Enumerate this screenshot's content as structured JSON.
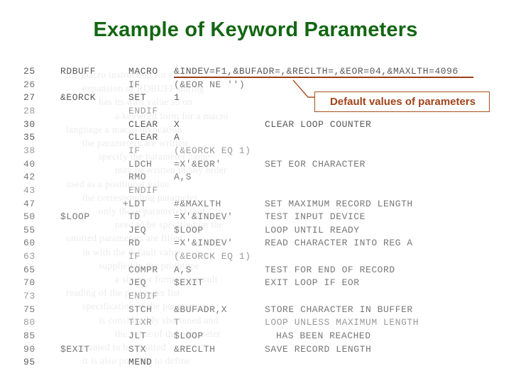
{
  "slide": {
    "title": "Example of Keyword Parameters",
    "title_color": "#136613"
  },
  "callout": {
    "text": "Default values of parameters",
    "color": "#a0441c",
    "border_color": "#a8511f",
    "leader_icon": "leader-line-icon"
  },
  "listing": {
    "underline_color": "#a03c17",
    "columns": [
      "line",
      "label",
      "opcode",
      "operand",
      "comment"
    ],
    "rows": [
      {
        "line": "25",
        "label": "RDBUFF",
        "plus": "",
        "opcode": "MACRO",
        "operand": "&INDEV=F1,&BUFADR=,&RECLTH=,&EOR=04,&MAXLTH=4096",
        "comment": "",
        "underline": true,
        "tone": "dark"
      },
      {
        "line": "26",
        "label": "",
        "plus": "",
        "opcode": "IF",
        "operand": "(&EOR NE '')",
        "comment": "",
        "underline": false,
        "tone": "mid"
      },
      {
        "line": "27",
        "label": "&EORCK",
        "plus": "",
        "opcode": "SET",
        "operand": "1",
        "comment": "",
        "underline": false,
        "tone": "dark"
      },
      {
        "line": "28",
        "label": "",
        "plus": "",
        "opcode": "ENDIF",
        "operand": "",
        "comment": "",
        "underline": false,
        "tone": "light"
      },
      {
        "line": "30",
        "label": "",
        "plus": "",
        "opcode": "CLEAR",
        "operand": "X",
        "comment": "CLEAR LOOP COUNTER",
        "underline": false,
        "tone": "dark"
      },
      {
        "line": "35",
        "label": "",
        "plus": "",
        "opcode": "CLEAR",
        "operand": "A",
        "comment": "",
        "underline": false,
        "tone": "dark"
      },
      {
        "line": "38",
        "label": "",
        "plus": "",
        "opcode": "IF",
        "operand": "(&EORCK EQ 1)",
        "comment": "",
        "underline": false,
        "tone": "light"
      },
      {
        "line": "40",
        "label": "",
        "plus": "",
        "opcode": "LDCH",
        "operand": "=X'&EOR'",
        "comment": "SET EOR CHARACTER",
        "underline": false,
        "tone": "mid"
      },
      {
        "line": "42",
        "label": "",
        "plus": "",
        "opcode": "RMO",
        "operand": "A,S",
        "comment": "",
        "underline": false,
        "tone": "mid"
      },
      {
        "line": "43",
        "label": "",
        "plus": "",
        "opcode": "ENDIF",
        "operand": "",
        "comment": "",
        "underline": false,
        "tone": "light"
      },
      {
        "line": "47",
        "label": "",
        "plus": "+",
        "opcode": "LDT",
        "operand": "#&MAXLTH",
        "comment": "SET MAXIMUM RECORD LENGTH",
        "underline": false,
        "tone": "mid"
      },
      {
        "line": "50",
        "label": "$LOOP",
        "plus": "",
        "opcode": "TD",
        "operand": "=X'&INDEV'",
        "comment": "TEST INPUT DEVICE",
        "underline": false,
        "tone": "mid"
      },
      {
        "line": "55",
        "label": "",
        "plus": "",
        "opcode": "JEQ",
        "operand": "$LOOP",
        "comment": "LOOP UNTIL READY",
        "underline": false,
        "tone": "mid"
      },
      {
        "line": "60",
        "label": "",
        "plus": "",
        "opcode": "RD",
        "operand": "=X'&INDEV'",
        "comment": "READ CHARACTER INTO REG A",
        "underline": false,
        "tone": "mid"
      },
      {
        "line": "63",
        "label": "",
        "plus": "",
        "opcode": "IF",
        "operand": "(&EORCK EQ 1)",
        "comment": "",
        "underline": false,
        "tone": "light"
      },
      {
        "line": "65",
        "label": "",
        "plus": "",
        "opcode": "COMPR",
        "operand": "A,S",
        "comment": "TEST FOR END OF RECORD",
        "underline": false,
        "tone": "mid"
      },
      {
        "line": "70",
        "label": "",
        "plus": "",
        "opcode": "JEQ",
        "operand": "$EXIT",
        "comment": "EXIT LOOP IF EOR",
        "underline": false,
        "tone": "mid"
      },
      {
        "line": "73",
        "label": "",
        "plus": "",
        "opcode": "ENDIF",
        "operand": "",
        "comment": "",
        "underline": false,
        "tone": "light"
      },
      {
        "line": "75",
        "label": "",
        "plus": "",
        "opcode": "STCH",
        "operand": "&BUFADR,X",
        "comment": "STORE CHARACTER IN BUFFER",
        "underline": false,
        "tone": "mid"
      },
      {
        "line": "80",
        "label": "",
        "plus": "",
        "opcode": "TIXR",
        "operand": "T",
        "comment": "LOOP UNLESS MAXIMUM LENGTH",
        "underline": false,
        "tone": "light"
      },
      {
        "line": "85",
        "label": "",
        "plus": "",
        "opcode": "JLT",
        "operand": "$LOOP",
        "comment": "HAS BEEN REACHED",
        "underline": false,
        "tone": "mid",
        "comment_indent": true
      },
      {
        "line": "90",
        "label": "$EXIT",
        "plus": "",
        "opcode": "STX",
        "operand": "&RECLTH",
        "comment": "SAVE RECORD LENGTH",
        "underline": false,
        "tone": "mid"
      },
      {
        "line": "95",
        "label": "",
        "plus": "",
        "opcode": "MEND",
        "operand": "",
        "comment": "",
        "underline": false,
        "tone": "dark"
      }
    ]
  },
  "ghost_text": {
    "lines": [
      "the macro instruction for each",
      "expansion of RDBUFF during",
      "has its own value so on",
      "a keyword form for a macro",
      "language a macro invocation",
      "the parameters are written",
      "specify the parameter name",
      "may be written in any order",
      "used as a positional value",
      "the corresponding parameter",
      "only those parameters that",
      "need to be specified on the",
      "omitted parameters are filled",
      "in with the default values",
      "supplied in the prototype",
      "a simpler form as a result",
      "reading of the parameter list",
      "specification of the parameters",
      "is considerably shortened and",
      "the value of the parameter",
      "is assumed to be omitted",
      "it is also possible to define"
    ]
  }
}
